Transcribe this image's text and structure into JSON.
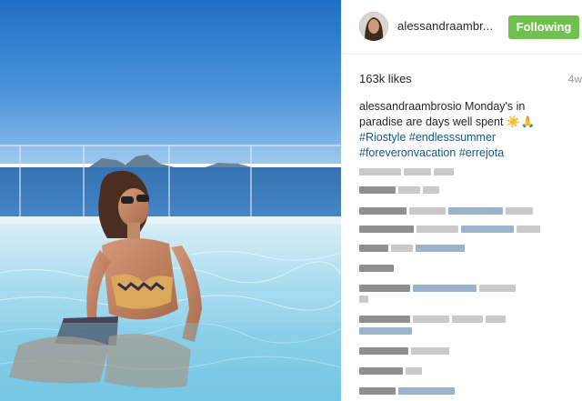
{
  "post": {
    "username": "alessandraambr...",
    "follow_label": "Following",
    "likes": "163k likes",
    "age": "4w",
    "caption": {
      "author": "alessandraambrosio",
      "text": "Monday's in paradise are days well spent ☀️🙏",
      "hashtags": [
        "#Riostyle",
        "#endlesssummer",
        "#foreveronvacation",
        "#errejota"
      ]
    }
  },
  "colors": {
    "follow_button": "#70c050",
    "hashtag": "#125688",
    "muted_text": "#999999"
  },
  "icons": [
    "avatar"
  ]
}
